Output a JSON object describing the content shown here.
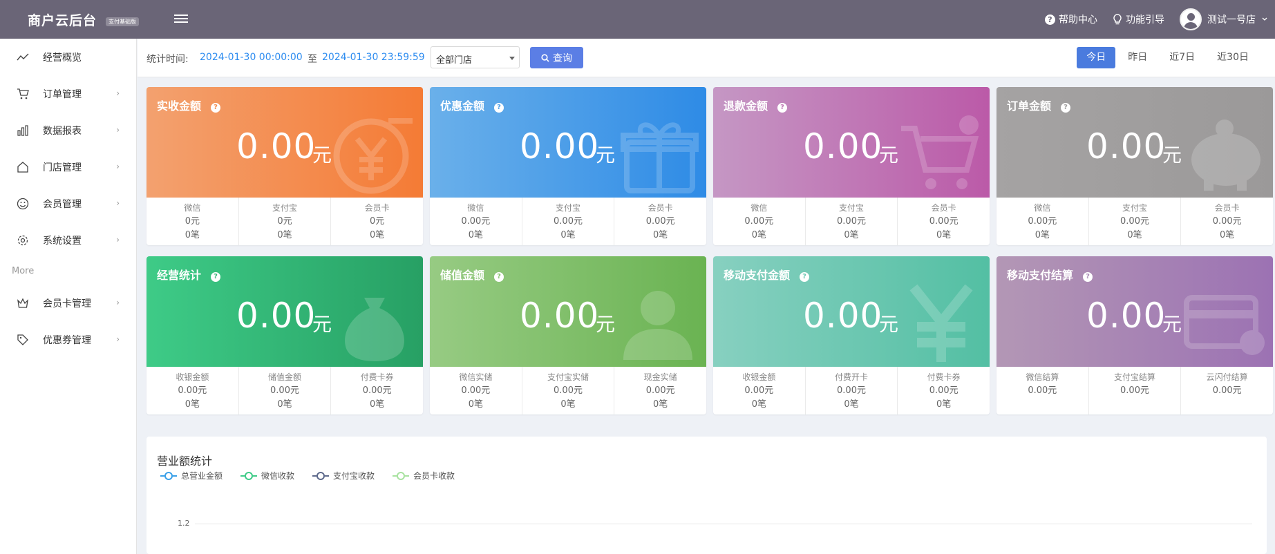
{
  "header": {
    "brand": "商户云后台",
    "brand_badge": "支付基础版",
    "help_center": "帮助中心",
    "feature_guide": "功能引导",
    "user_name": "测试一号店"
  },
  "sidebar": {
    "items": [
      {
        "label": "经营概览",
        "icon": "trend-line-icon"
      },
      {
        "label": "订单管理",
        "icon": "cart-icon"
      },
      {
        "label": "数据报表",
        "icon": "bar-chart-icon"
      },
      {
        "label": "门店管理",
        "icon": "home-icon"
      },
      {
        "label": "会员管理",
        "icon": "smile-icon"
      },
      {
        "label": "系统设置",
        "icon": "gear-icon"
      }
    ],
    "more_label": "More",
    "more_items": [
      {
        "label": "会员卡管理",
        "icon": "crown-icon"
      },
      {
        "label": "优惠券管理",
        "icon": "tag-icon"
      }
    ]
  },
  "toolbar": {
    "time_label": "统计时间:",
    "start_time": "2024-01-30 00:00:00",
    "to_label": "至",
    "end_time": "2024-01-30 23:59:59",
    "store_select": "全部门店",
    "query_label": "查询",
    "ranges": [
      "今日",
      "昨日",
      "近7日",
      "近30日"
    ],
    "active_range": "今日"
  },
  "cards": [
    {
      "title": "实收金额",
      "value": "0.00",
      "unit": "元",
      "bg_icon": "yen-coin-icon",
      "cols": [
        {
          "name": "微信",
          "amount": "0元",
          "count": "0笔"
        },
        {
          "name": "支付宝",
          "amount": "0元",
          "count": "0笔"
        },
        {
          "name": "会员卡",
          "amount": "0元",
          "count": "0笔"
        }
      ]
    },
    {
      "title": "优惠金额",
      "value": "0.00",
      "unit": "元",
      "bg_icon": "gift-icon",
      "cols": [
        {
          "name": "微信",
          "amount": "0.00元",
          "count": "0笔"
        },
        {
          "name": "支付宝",
          "amount": "0.00元",
          "count": "0笔"
        },
        {
          "name": "会员卡",
          "amount": "0.00元",
          "count": "0笔"
        }
      ]
    },
    {
      "title": "退款金额",
      "value": "0.00",
      "unit": "元",
      "bg_icon": "cart-remove-icon",
      "cols": [
        {
          "name": "微信",
          "amount": "0.00元",
          "count": "0笔"
        },
        {
          "name": "支付宝",
          "amount": "0.00元",
          "count": "0笔"
        },
        {
          "name": "会员卡",
          "amount": "0.00元",
          "count": "0笔"
        }
      ]
    },
    {
      "title": "订单金额",
      "value": "0.00",
      "unit": "元",
      "bg_icon": "piggy-bank-icon",
      "cols": [
        {
          "name": "微信",
          "amount": "0.00元",
          "count": "0笔"
        },
        {
          "name": "支付宝",
          "amount": "0.00元",
          "count": "0笔"
        },
        {
          "name": "会员卡",
          "amount": "0.00元",
          "count": "0笔"
        }
      ]
    },
    {
      "title": "经营统计",
      "value": "0.00",
      "unit": "元",
      "bg_icon": "money-bag-icon",
      "cols": [
        {
          "name": "收银金额",
          "amount": "0.00元",
          "count": "0笔"
        },
        {
          "name": "储值金额",
          "amount": "0.00元",
          "count": "0笔"
        },
        {
          "name": "付费卡券",
          "amount": "0.00元",
          "count": "0笔"
        }
      ]
    },
    {
      "title": "储值金额",
      "value": "0.00",
      "unit": "元",
      "bg_icon": "users-icon",
      "cols": [
        {
          "name": "微信实储",
          "amount": "0.00元",
          "count": "0笔"
        },
        {
          "name": "支付宝实储",
          "amount": "0.00元",
          "count": "0笔"
        },
        {
          "name": "现金实储",
          "amount": "0.00元",
          "count": "0笔"
        }
      ]
    },
    {
      "title": "移动支付金额",
      "value": "0.00",
      "unit": "元",
      "bg_icon": "yen-icon",
      "cols": [
        {
          "name": "收银金额",
          "amount": "0.00元",
          "count": "0笔"
        },
        {
          "name": "付费开卡",
          "amount": "0.00元",
          "count": "0笔"
        },
        {
          "name": "付费卡券",
          "amount": "0.00元",
          "count": "0笔"
        }
      ]
    },
    {
      "title": "移动支付结算",
      "value": "0.00",
      "unit": "元",
      "bg_icon": "credit-card-icon",
      "cols": [
        {
          "name": "微信结算",
          "amount": "0.00元"
        },
        {
          "name": "支付宝结算",
          "amount": "0.00元"
        },
        {
          "name": "云闪付结算",
          "amount": "0.00元"
        }
      ]
    }
  ],
  "colors": {
    "header_bg": "#6a6577",
    "accent_blue": "#4a7bde",
    "query_btn": "#5b7ee5",
    "date_text": "#2d8cf0"
  },
  "chart_data": {
    "type": "line",
    "title": "营业额统计",
    "series": [
      {
        "name": "总营业金额",
        "color": "#3aa0e8",
        "values": []
      },
      {
        "name": "微信收款",
        "color": "#3ecb87",
        "values": []
      },
      {
        "name": "支付宝收款",
        "color": "#5e6a8c",
        "values": []
      },
      {
        "name": "会员卡收款",
        "color": "#a8e2a0",
        "values": []
      }
    ],
    "y_ticks_visible": [
      "1.2"
    ],
    "grid": true,
    "legend_position": "top-left"
  }
}
